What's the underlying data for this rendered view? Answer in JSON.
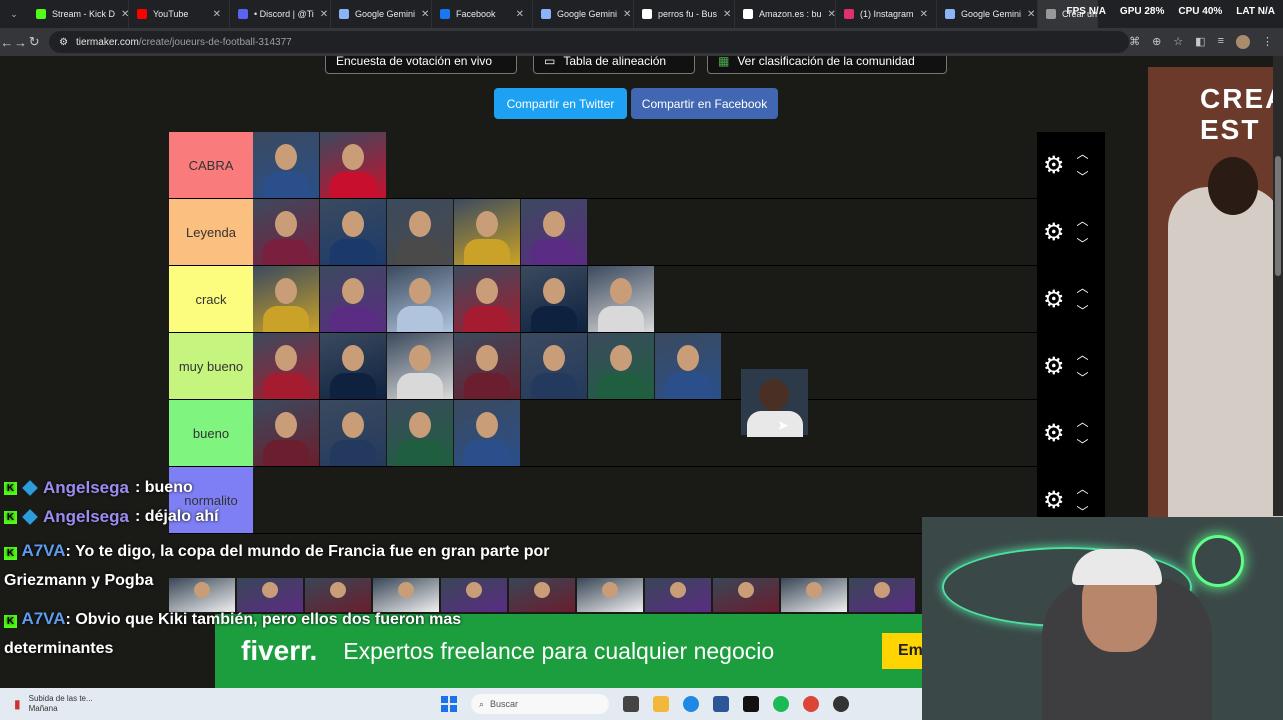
{
  "browser": {
    "tabs": [
      {
        "label": "Stream - Kick D",
        "color": "#53fc18"
      },
      {
        "label": "YouTube",
        "color": "#ff0000"
      },
      {
        "label": "• Discord | @Ti",
        "color": "#5865f2"
      },
      {
        "label": "Google Gemini",
        "color": "#8ab4f8"
      },
      {
        "label": "Facebook",
        "color": "#1877f2"
      },
      {
        "label": "Google Gemini",
        "color": "#8ab4f8"
      },
      {
        "label": "perros fu - Bus",
        "color": "#ffffff"
      },
      {
        "label": "Amazon.es : bu",
        "color": "#ffffff"
      },
      {
        "label": "(1) Instagram",
        "color": "#e1306c"
      },
      {
        "label": "Google Gemini",
        "color": "#8ab4f8"
      },
      {
        "label": "Crear una list",
        "color": "#999999"
      }
    ],
    "hud": {
      "fps": "FPS N/A",
      "gpu": "GPU 28%",
      "cpu": "CPU 40%",
      "lat": "LAT N/A"
    },
    "url_host": "tiermaker.com",
    "url_path": "/create/joueurs-de-football-314377"
  },
  "page": {
    "top_buttons": [
      "Encuesta de votación en vivo",
      "Tabla de alineación",
      "Ver clasificación de la comunidad"
    ],
    "share_twitter": "Compartir en Twitter",
    "share_facebook": "Compartir en Facebook",
    "tiers": [
      {
        "label": "CABRA",
        "color": "#f97b7b",
        "count": 2
      },
      {
        "label": "Leyenda",
        "color": "#fbbf7f",
        "count": 5
      },
      {
        "label": "crack",
        "color": "#fcfc7f",
        "count": 6
      },
      {
        "label": "muy bueno",
        "color": "#c6f57f",
        "count": 7
      },
      {
        "label": "bueno",
        "color": "#7ff57f",
        "count": 4
      },
      {
        "label": "normalito",
        "color": "#7f7ff5",
        "count": 0
      }
    ]
  },
  "chat": [
    {
      "user": "Angelsega",
      "message": ": bueno"
    },
    {
      "user": "Angelsega",
      "message": ": déjalo ahí"
    },
    {
      "user": "A7VA",
      "message": ": Yo te digo, la copa del mundo de Francia fue en gran parte por Griezmann y Pogba"
    },
    {
      "user": "A7VA",
      "message": ": Obvio que Kiki también, pero ellos dos fueron mas determinantes"
    }
  ],
  "ad": {
    "logo": "fiverr.",
    "tagline": "Expertos freelance para cualquier negocio",
    "cta": "Em"
  },
  "poster": {
    "title": "CREA\nEST"
  },
  "taskbar": {
    "note_title": "Subida de las te...",
    "note_sub": "Mañana",
    "search": "Buscar"
  }
}
